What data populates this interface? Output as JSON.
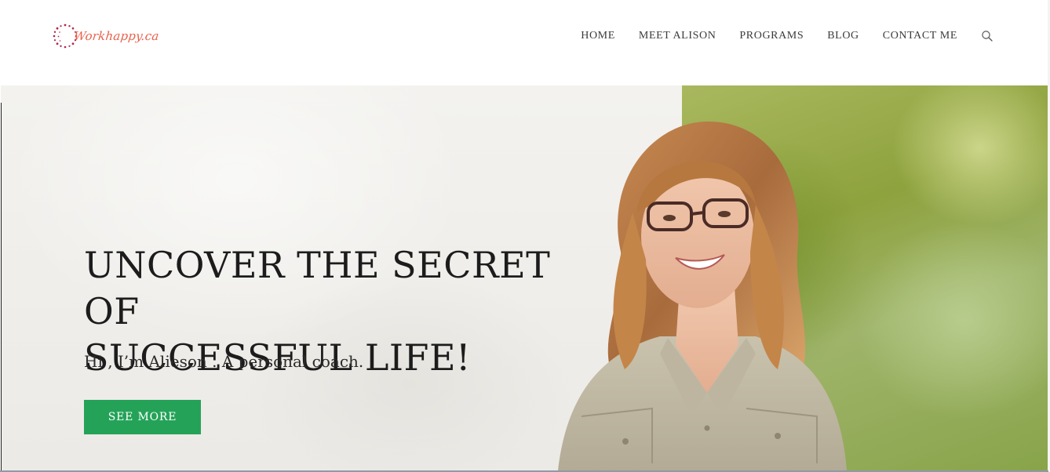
{
  "brand": {
    "logo_text": "Workhappy.ca",
    "logo_color": "#e8604c",
    "ring_color": "#b3264a"
  },
  "nav": {
    "items": [
      {
        "label": "HOME"
      },
      {
        "label": "MEET ALISON"
      },
      {
        "label": "PROGRAMS"
      },
      {
        "label": "BLOG"
      },
      {
        "label": "CONTACT ME"
      }
    ],
    "search_icon": "search-icon"
  },
  "hero": {
    "title_line1": "UNCOVER THE SECRET OF",
    "title_line2": "SUCCESSFUL LIFE!",
    "subtitle": "Hi , I’m Alieson . A personal coach.",
    "button_label": "SEE MORE",
    "button_color": "#24a358",
    "background_image": "smiling woman with glasses in front of green meadow"
  }
}
